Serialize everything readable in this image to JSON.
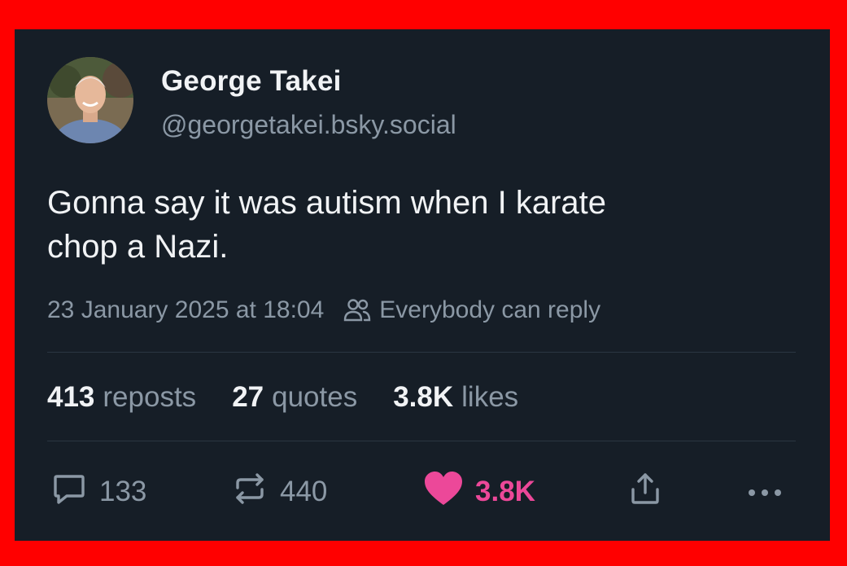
{
  "author": {
    "name": "George Takei",
    "handle": "@georgetakei.bsky.social"
  },
  "post": {
    "text_line1": "Gonna say it was autism when I karate",
    "text_line2": "chop a Nazi.",
    "timestamp": "23 January 2025 at 18:04",
    "reply_setting": "Everybody can reply"
  },
  "stats": {
    "reposts_count": "413",
    "reposts_label": "reposts",
    "quotes_count": "27",
    "quotes_label": "quotes",
    "likes_count": "3.8K",
    "likes_label": "likes"
  },
  "actions": {
    "reply_count": "133",
    "repost_count": "440",
    "like_count": "3.8K"
  },
  "icons": {
    "reply": "reply-icon",
    "repost": "repost-icon",
    "like": "heart-icon",
    "share": "share-icon",
    "more": "more-icon",
    "audience": "people-icon"
  },
  "colors": {
    "border": "#ff0000",
    "background": "#161e27",
    "text_primary": "#f1f3f5",
    "text_secondary": "#8b98a5",
    "like": "#ec4899"
  }
}
